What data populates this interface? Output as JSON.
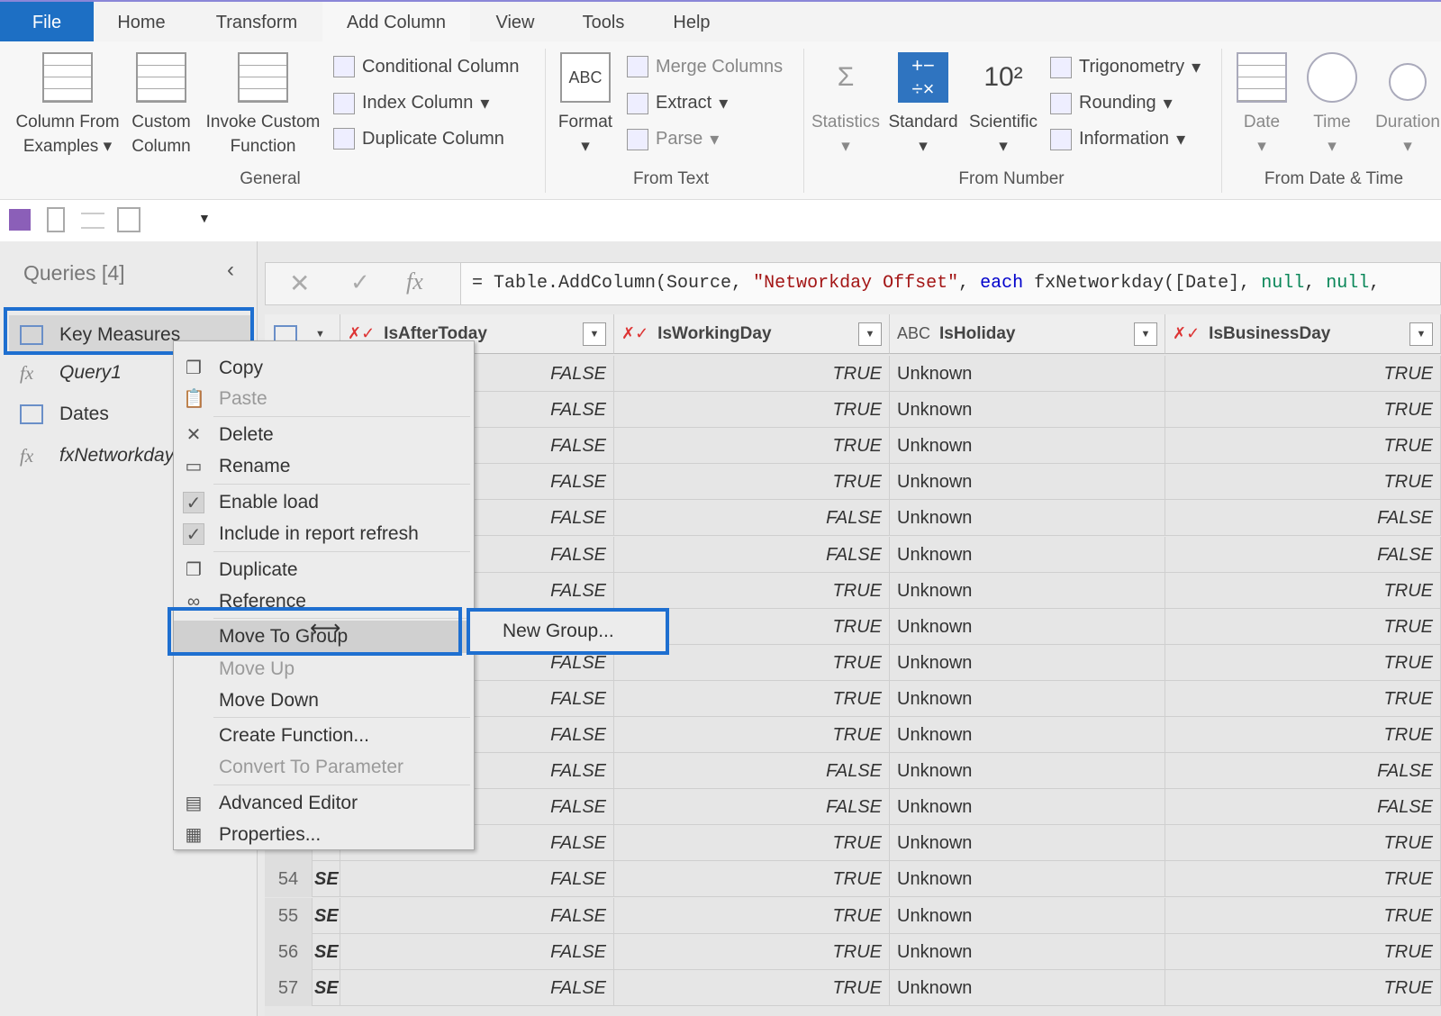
{
  "tabs": [
    "File",
    "Home",
    "Transform",
    "Add Column",
    "View",
    "Tools",
    "Help"
  ],
  "ribbon": {
    "general": {
      "label": "General",
      "column_from_examples": "Column From",
      "column_from_examples2": "Examples",
      "custom_column": "Custom",
      "custom_column2": "Column",
      "invoke_custom": "Invoke Custom",
      "invoke_custom2": "Function",
      "conditional_column": "Conditional Column",
      "index_column": "Index Column",
      "duplicate_column": "Duplicate Column"
    },
    "from_text": {
      "label": "From Text",
      "format": "Format",
      "merge_columns": "Merge Columns",
      "extract": "Extract",
      "parse": "Parse"
    },
    "from_number": {
      "label": "From Number",
      "statistics": "Statistics",
      "standard": "Standard",
      "scientific": "Scientific",
      "trigonometry": "Trigonometry",
      "rounding": "Rounding",
      "information": "Information"
    },
    "from_datetime": {
      "label": "From Date & Time",
      "date": "Date",
      "time": "Time",
      "duration": "Duration"
    }
  },
  "queries": {
    "header": "Queries [4]",
    "items": [
      {
        "name": "Key Measures",
        "type": "table"
      },
      {
        "name": "Query1",
        "type": "fx"
      },
      {
        "name": "Dates",
        "type": "table"
      },
      {
        "name": "fxNetworkday",
        "type": "fx"
      }
    ]
  },
  "formula": {
    "prefix": "= Table.AddColumn(Source, ",
    "string": "\"Networkday Offset\"",
    "comma": ", ",
    "keyword": "each",
    "call": " fxNetworkday([Date], ",
    "null1": "null",
    "sep": ", ",
    "null2": "null",
    "tail": ","
  },
  "columns": [
    {
      "name": "IsAfterToday",
      "type": "logical"
    },
    {
      "name": "IsWorkingDay",
      "type": "logical"
    },
    {
      "name": "IsHoliday",
      "type": "text"
    },
    {
      "name": "IsBusinessDay",
      "type": "logical"
    }
  ],
  "rows": [
    {
      "n": "",
      "c": "",
      "a": "FALSE",
      "w": "TRUE",
      "h": "Unknown",
      "b": "TRUE"
    },
    {
      "n": "",
      "c": "",
      "a": "FALSE",
      "w": "TRUE",
      "h": "Unknown",
      "b": "TRUE"
    },
    {
      "n": "",
      "c": "",
      "a": "FALSE",
      "w": "TRUE",
      "h": "Unknown",
      "b": "TRUE"
    },
    {
      "n": "",
      "c": "",
      "a": "FALSE",
      "w": "TRUE",
      "h": "Unknown",
      "b": "TRUE"
    },
    {
      "n": "",
      "c": "",
      "a": "FALSE",
      "w": "FALSE",
      "h": "Unknown",
      "b": "FALSE"
    },
    {
      "n": "",
      "c": "",
      "a": "FALSE",
      "w": "FALSE",
      "h": "Unknown",
      "b": "FALSE"
    },
    {
      "n": "",
      "c": "",
      "a": "FALSE",
      "w": "TRUE",
      "h": "Unknown",
      "b": "TRUE"
    },
    {
      "n": "",
      "c": "",
      "a": "FALSE",
      "w": "TRUE",
      "h": "Unknown",
      "b": "TRUE"
    },
    {
      "n": "",
      "c": "",
      "a": "FALSE",
      "w": "TRUE",
      "h": "Unknown",
      "b": "TRUE"
    },
    {
      "n": "",
      "c": "",
      "a": "FALSE",
      "w": "TRUE",
      "h": "Unknown",
      "b": "TRUE"
    },
    {
      "n": "",
      "c": "",
      "a": "FALSE",
      "w": "TRUE",
      "h": "Unknown",
      "b": "TRUE"
    },
    {
      "n": "",
      "c": "",
      "a": "FALSE",
      "w": "FALSE",
      "h": "Unknown",
      "b": "FALSE"
    },
    {
      "n": "",
      "c": "",
      "a": "FALSE",
      "w": "FALSE",
      "h": "Unknown",
      "b": "FALSE"
    },
    {
      "n": "",
      "c": "",
      "a": "FALSE",
      "w": "TRUE",
      "h": "Unknown",
      "b": "TRUE"
    },
    {
      "n": "54",
      "c": "SE",
      "a": "FALSE",
      "w": "TRUE",
      "h": "Unknown",
      "b": "TRUE"
    },
    {
      "n": "55",
      "c": "SE",
      "a": "FALSE",
      "w": "TRUE",
      "h": "Unknown",
      "b": "TRUE"
    },
    {
      "n": "56",
      "c": "SE",
      "a": "FALSE",
      "w": "TRUE",
      "h": "Unknown",
      "b": "TRUE"
    },
    {
      "n": "57",
      "c": "SE",
      "a": "FALSE",
      "w": "TRUE",
      "h": "Unknown",
      "b": "TRUE"
    }
  ],
  "context_menu": [
    {
      "label": "Copy",
      "icon": "copy-icon",
      "disabled": false
    },
    {
      "label": "Paste",
      "icon": "paste-icon",
      "disabled": true
    },
    {
      "label": "Delete",
      "icon": "close-icon",
      "disabled": false,
      "sep": true
    },
    {
      "label": "Rename",
      "icon": "rename-icon",
      "disabled": false
    },
    {
      "label": "Enable load",
      "icon": "check-icon",
      "disabled": false,
      "sep": true
    },
    {
      "label": "Include in report refresh",
      "icon": "check-icon",
      "disabled": false
    },
    {
      "label": "Duplicate",
      "icon": "duplicate-icon",
      "disabled": false,
      "sep": true
    },
    {
      "label": "Reference",
      "icon": "reference-icon",
      "disabled": false
    },
    {
      "label": "Move To Group",
      "icon": "",
      "disabled": false,
      "highlighted": true,
      "sep": true
    },
    {
      "label": "Move Up",
      "icon": "",
      "disabled": true
    },
    {
      "label": "Move Down",
      "icon": "",
      "disabled": false
    },
    {
      "label": "Create Function...",
      "icon": "",
      "disabled": false,
      "sep": true
    },
    {
      "label": "Convert To Parameter",
      "icon": "",
      "disabled": true
    },
    {
      "label": "Advanced Editor",
      "icon": "advanced-editor-icon",
      "disabled": false,
      "sep": true
    },
    {
      "label": "Properties...",
      "icon": "properties-icon",
      "disabled": false
    }
  ],
  "submenu": {
    "new_group": "New Group..."
  },
  "colors": {
    "accent": "#1e6fd0",
    "file_tab": "#1d6fc4",
    "string": "#a31515",
    "keyword": "#0000ff",
    "null": "#098658"
  }
}
